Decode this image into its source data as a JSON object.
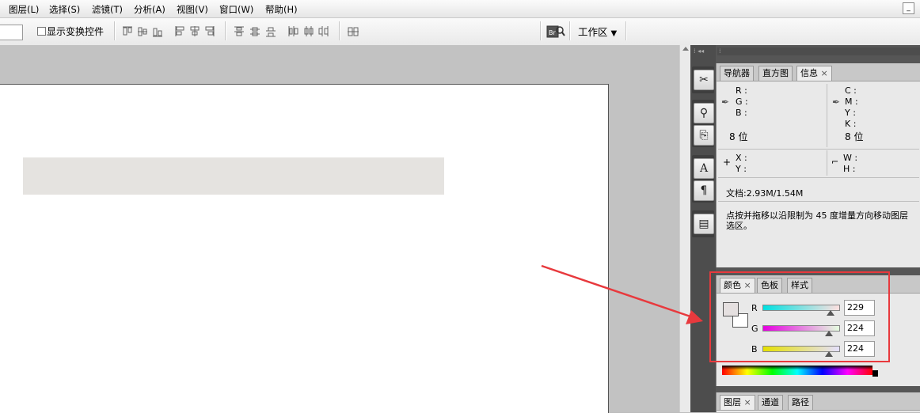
{
  "menubar": {
    "items": [
      "图层(L)",
      "选择(S)",
      "滤镜(T)",
      "分析(A)",
      "视图(V)",
      "窗口(W)",
      "帮助(H)"
    ],
    "minimize_symbol": "_"
  },
  "options_bar": {
    "show_transform_label": "显示变换控件",
    "align_top_label": "▫▫▫",
    "workspace_label": "工作区",
    "workspace_arrow": "▼"
  },
  "info_panel": {
    "tabs": [
      "导航器",
      "直方图",
      "信息"
    ],
    "close_symbol": "×",
    "rgb_labels": [
      "R :",
      "G :",
      "B :"
    ],
    "cmyk_labels": [
      "C :",
      "M :",
      "Y :",
      "K :"
    ],
    "bits_left": "8 位",
    "bits_right": "8 位",
    "xy_labels": [
      "X :",
      "Y :"
    ],
    "wh_labels": [
      "W :",
      "H :"
    ],
    "doc_size": "文档:2.93M/1.54M",
    "hint_line1": "点按并拖移以沿限制为 45 度增量方向移动图层",
    "hint_line2": "选区。"
  },
  "color_panel": {
    "tabs": [
      "颜色",
      "色板",
      "样式"
    ],
    "close_symbol": "×",
    "channels": [
      {
        "label": "R",
        "value": "229",
        "fraction": 0.898
      },
      {
        "label": "G",
        "value": "224",
        "fraction": 0.878
      },
      {
        "label": "B",
        "value": "224",
        "fraction": 0.878
      }
    ],
    "foreground_color": "#e5e0e0",
    "background_color": "#ffffff"
  },
  "layers_panel": {
    "tabs": [
      "图层",
      "通道",
      "路径"
    ],
    "close_symbol": "×"
  },
  "canvas": {
    "bar_color": "#e5e3e0"
  },
  "annotation": {
    "highlight_color": "#e8393d"
  }
}
